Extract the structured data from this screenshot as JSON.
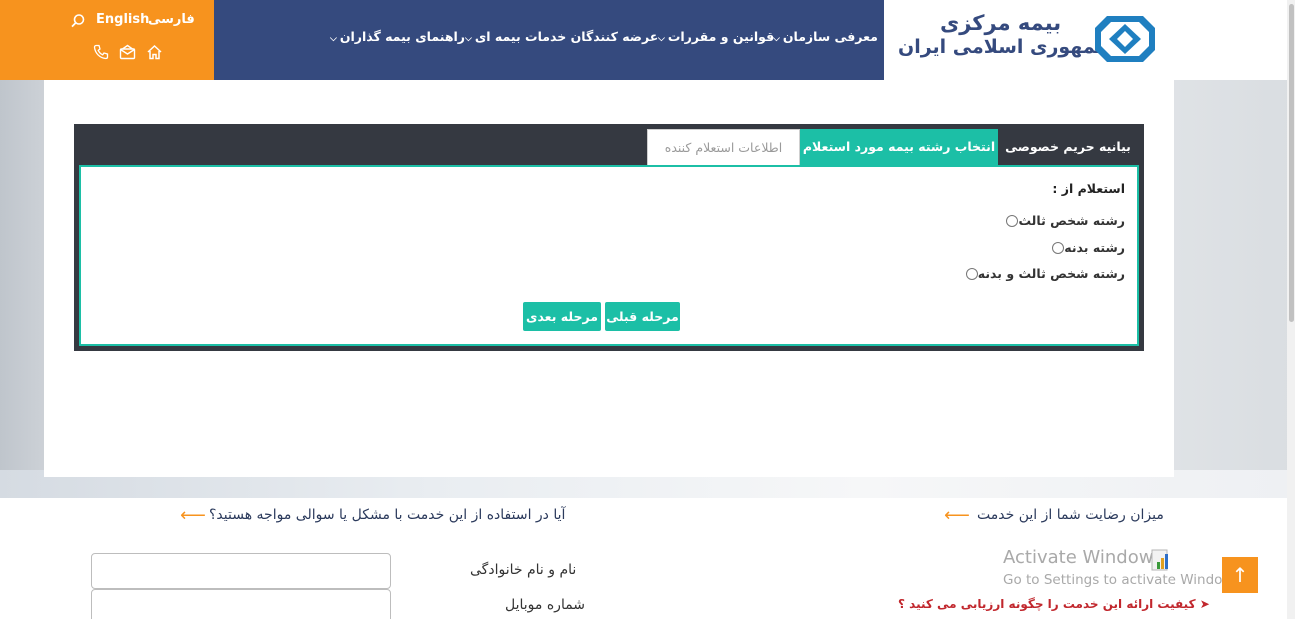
{
  "header": {
    "lang_fa": "فارسی",
    "lang_en": "English",
    "nav": [
      "معرفی سازمان",
      "قوانین و مقررات",
      "عرضه کنندگان خدمات بیمه ای",
      "راهنمای بیمه گذاران"
    ],
    "logo_line1": "بیمه مرکزی",
    "logo_line2": "جمهوری اسلامی ایران",
    "icons": [
      "search-icon",
      "phone-icon",
      "mail-icon",
      "home-icon"
    ]
  },
  "tabs": {
    "privacy": "بیانیه حریم خصوصی",
    "select": "انتخاب رشته بیمه مورد استعلام",
    "info": "اطلاعات استعلام کننده"
  },
  "form": {
    "question": "استعلام از :",
    "options": [
      "رشته شخص ثالث",
      "رشته بدنه",
      "رشته شخص ثالث و بدنه"
    ],
    "prev_button": "مرحله قبلی",
    "next_button": "مرحله بعدی"
  },
  "footer": {
    "satisfaction_title": "میزان رضایت شما از این خدمت",
    "problem_title": "آیا در استفاده از این خدمت با مشکل یا سوالی مواجه هستید؟",
    "name_label": "نام و نام خانوادگی",
    "mobile_label": "شماره موبایل",
    "quality_question": "کیفیت ارائه این خدمت را چگونه ارزیابی می کنید ؟",
    "activate_line1": "Activate Windows",
    "activate_line2": "Go to Settings to activate Windows.",
    "to_top": "↑"
  },
  "colors": {
    "orange": "#f7931e",
    "navy": "#354a7e",
    "teal": "#1cbfa6",
    "panel": "#353941"
  }
}
